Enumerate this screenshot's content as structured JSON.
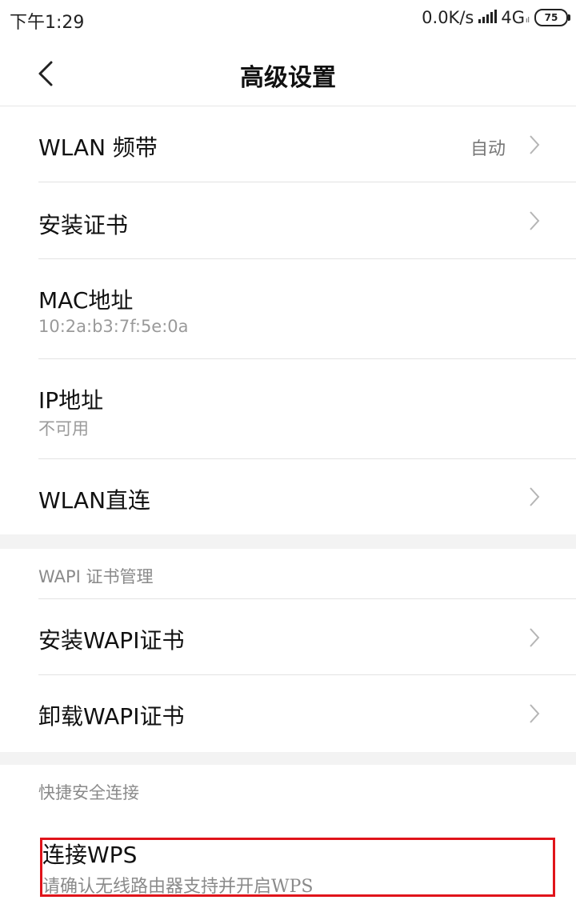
{
  "status_bar": {
    "time": "下午1:29",
    "net_speed": "0.0K/s",
    "network": "4G",
    "network_sub": "ıl",
    "battery": "75"
  },
  "header": {
    "title": "高级设置"
  },
  "rows": [
    {
      "label": "WLAN 频带",
      "value": "自动"
    },
    {
      "label": "安装证书"
    },
    {
      "label": "MAC地址",
      "sub": "10:2a:b3:7f:5e:0a"
    },
    {
      "label": "IP地址",
      "sub": "不可用"
    },
    {
      "label": "WLAN直连"
    }
  ],
  "wapi_section": {
    "header": "WAPI 证书管理",
    "rows": [
      {
        "label": "安装WAPI证书"
      },
      {
        "label": "卸载WAPI证书"
      }
    ]
  },
  "quick_section": {
    "header": "快捷安全连接",
    "wps_title": "连接WPS",
    "wps_sub": "请确认无线路由器支持并开启WPS"
  },
  "colors": {
    "highlight_box": "#e0141a",
    "divider": "#e3e3e3",
    "section_gap": "#f3f3f3"
  }
}
